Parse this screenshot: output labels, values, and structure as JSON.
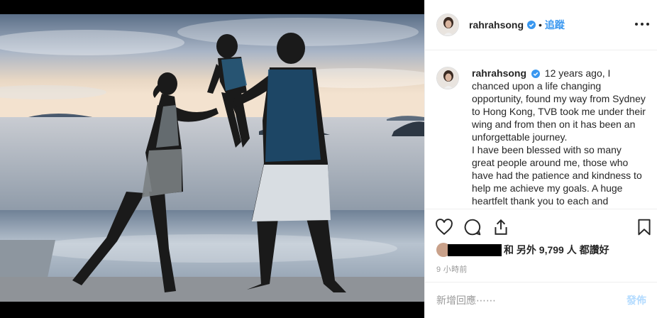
{
  "post": {
    "photo_alt": "",
    "colors": {
      "accent": "#3897f0",
      "verified": "#3897f0",
      "border": "#efefef",
      "muted": "#999999"
    }
  },
  "header": {
    "username": "rahrahsong",
    "dot": "•",
    "follow_label": "追蹤"
  },
  "caption": {
    "username": "rahrahsong",
    "text": "12 years ago, I chanced upon a life changing opportunity, found my way from Sydney to Hong Kong, TVB took me under their wing and from then on it has been an unforgettable journey.",
    "text2": "I have been blessed with so many great people around me, those who have had the patience and kindness to help me achieve my goals. A huge heartfelt thank you to each and"
  },
  "actions": {
    "icons": [
      "heart-icon",
      "comment-icon",
      "share-icon",
      "bookmark-icon"
    ]
  },
  "likes": {
    "text": "和 另外 9,799 人 都讚好"
  },
  "time_ago": "9 小時前",
  "comment": {
    "placeholder": "新增回應⋯⋯",
    "post_label": "發佈"
  }
}
